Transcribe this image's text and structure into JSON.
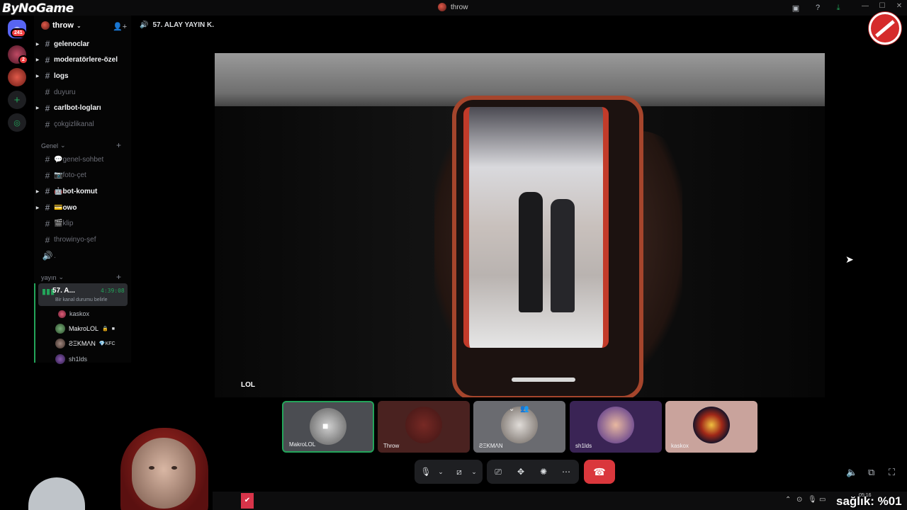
{
  "brand": "ByNoGame",
  "window": {
    "title": "throw"
  },
  "rail": {
    "dm_badge": "241",
    "server_badge": "2"
  },
  "server": {
    "name": "throw"
  },
  "channels": [
    {
      "name": "gelenoclar",
      "state": "bright",
      "bullet": true
    },
    {
      "name": "moderatörlere-özel",
      "state": "bright",
      "bullet": true
    },
    {
      "name": "logs",
      "state": "bright",
      "bullet": true
    },
    {
      "name": "duyuru",
      "state": "dim",
      "bullet": false
    },
    {
      "name": "carlbot-logları",
      "state": "bright",
      "bullet": true
    },
    {
      "name": "çokgizlikanal",
      "state": "dim",
      "bullet": false
    }
  ],
  "category_genel": {
    "label": "Genel"
  },
  "channels_genel": [
    {
      "name": "💬genel-sohbet",
      "state": "dim",
      "bullet": false
    },
    {
      "name": "📷foto-çet",
      "state": "dim",
      "bullet": false
    },
    {
      "name": "🤖bot-komut",
      "state": "bright",
      "bullet": true
    },
    {
      "name": "💳owo",
      "state": "bright",
      "bullet": true
    },
    {
      "name": "🎬klip",
      "state": "dim",
      "bullet": false
    },
    {
      "name": "throwinyo-şef",
      "state": "dim",
      "bullet": false
    },
    {
      "name": ".",
      "state": "dim",
      "bullet": false
    }
  ],
  "category_yayin": {
    "label": "yayın"
  },
  "voice_channel": {
    "name": "57. A...",
    "time": "4:39:08",
    "status": "Bir kanal durumu belirle"
  },
  "voice_users": [
    {
      "name": "kaskox",
      "tag": ""
    },
    {
      "name": "MakroLOL",
      "tag": ""
    },
    {
      "name": "ƧΞKMΛN",
      "tag": "KFC"
    },
    {
      "name": "sh1lds",
      "tag": ""
    }
  ],
  "main": {
    "channel_title": "57. ALAY YAYIN K.",
    "stage_label": "LOL"
  },
  "tiles": [
    {
      "name": "MakroLOL"
    },
    {
      "name": "Throw"
    },
    {
      "name": "ƧΞKMΛN"
    },
    {
      "name": "sh1lds"
    },
    {
      "name": "kaskox"
    }
  ],
  "overlay": {
    "text": "sağlık: %01",
    "clock": "05:16"
  },
  "colors": {
    "accent_green": "#23a55a",
    "danger": "#da373c",
    "badge": "#f23f42"
  },
  "icons": [
    "search-icon",
    "help-icon",
    "download-icon",
    "mic-icon",
    "camera-off-icon",
    "screen-share-icon",
    "activity-icon",
    "soundboard-icon",
    "more-icon",
    "leave-call-icon"
  ]
}
